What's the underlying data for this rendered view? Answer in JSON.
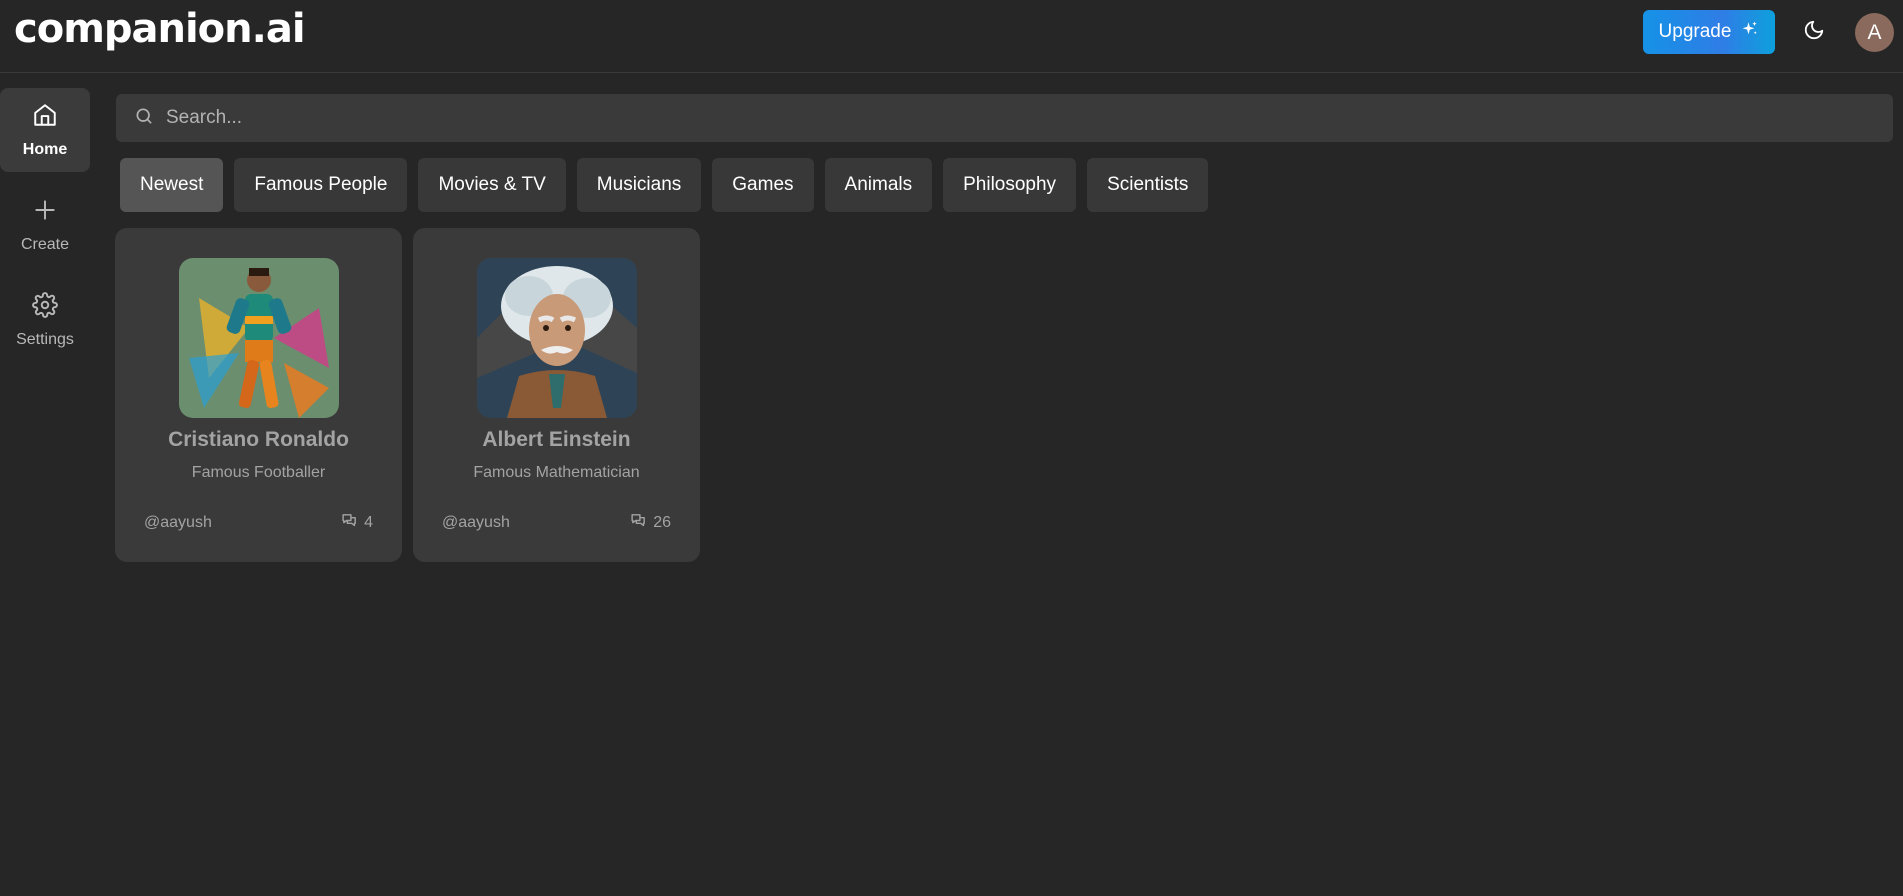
{
  "app": {
    "logo": "companion.ai"
  },
  "header": {
    "upgrade_label": "Upgrade",
    "upgrade_icon": "sparkles-icon",
    "theme_icon": "moon-icon",
    "avatar_initial": "A"
  },
  "sidebar": {
    "items": [
      {
        "label": "Home",
        "icon": "home-icon",
        "active": true
      },
      {
        "label": "Create",
        "icon": "plus-icon",
        "active": false
      },
      {
        "label": "Settings",
        "icon": "gear-icon",
        "active": false
      }
    ]
  },
  "search": {
    "placeholder": "Search...",
    "value": ""
  },
  "categories": [
    {
      "label": "Newest",
      "active": true
    },
    {
      "label": "Famous People"
    },
    {
      "label": "Movies & TV"
    },
    {
      "label": "Musicians"
    },
    {
      "label": "Games"
    },
    {
      "label": "Animals"
    },
    {
      "label": "Philosophy"
    },
    {
      "label": "Scientists"
    }
  ],
  "companions": [
    {
      "name": "Cristiano Ronaldo",
      "description": "Famous Footballer",
      "author": "@aayush",
      "messages": "4"
    },
    {
      "name": "Albert Einstein",
      "description": "Famous Mathematician",
      "author": "@aayush",
      "messages": "26"
    }
  ],
  "colors": {
    "background": "#262626",
    "surface": "#3a3a3a",
    "active_category": "#555555",
    "upgrade_gradient_start": "#1592e6",
    "upgrade_gradient_end": "#0ea0dc",
    "avatar": "#8a6a5c"
  }
}
